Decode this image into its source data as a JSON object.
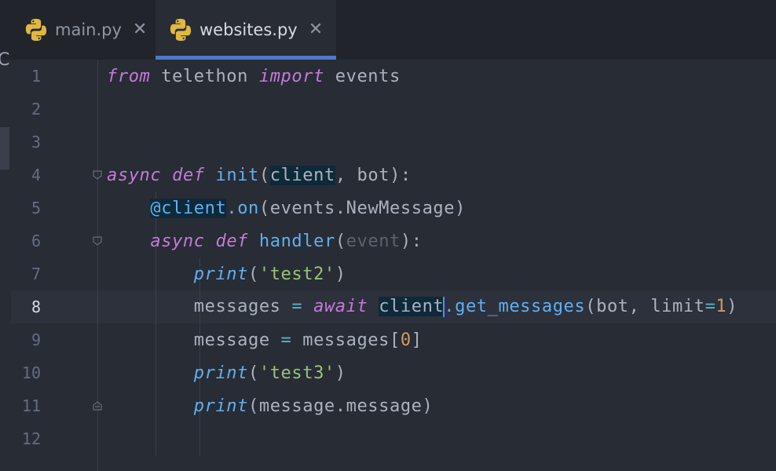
{
  "tabs": [
    {
      "label": "main.py",
      "close": "✕",
      "icon": "python-icon"
    },
    {
      "label": "websites.py",
      "close": "✕",
      "icon": "python-icon",
      "active": true
    }
  ],
  "edge_char": "C",
  "colors": {
    "keyword": "#c678dd",
    "function": "#61afef",
    "string": "#98c379",
    "number": "#d19a66",
    "operator": "#56b6c2",
    "text": "#abb2bf",
    "accent": "#4d78cc"
  },
  "editor": {
    "active_line": 8,
    "lines": [
      {
        "n": "1",
        "t": {
          "a": "from",
          "b": " telethon ",
          "c": "import",
          "d": " events"
        }
      },
      {
        "n": "2"
      },
      {
        "n": "3"
      },
      {
        "n": "4",
        "t": {
          "a": "async",
          "b": " ",
          "c": "def",
          "d": " ",
          "e": "init",
          "f": "(",
          "g": "client",
          "h": ", bot",
          "i": "):"
        }
      },
      {
        "n": "5",
        "t": {
          "a": "    ",
          "b": "@",
          "c": "client",
          "d": ".",
          "e": "on",
          "f": "(events.NewMessage)"
        }
      },
      {
        "n": "6",
        "t": {
          "a": "    ",
          "b": "async",
          "c": " ",
          "d": "def",
          "e": " ",
          "f": "handler",
          "g": "(",
          "h": "event",
          "i": "):"
        }
      },
      {
        "n": "7",
        "t": {
          "a": "        ",
          "b": "print",
          "c": "(",
          "d": "'test2'",
          "e": ")"
        }
      },
      {
        "n": "8",
        "t": {
          "a": "        messages ",
          "b": "=",
          "c": " ",
          "d": "await",
          "e": " ",
          "f": "client",
          "g": ".get_messages",
          "h": "(bot, limit",
          "i": "=",
          "j": "1",
          "k": ")"
        }
      },
      {
        "n": "9",
        "t": {
          "a": "        message ",
          "b": "=",
          "c": " messages[",
          "d": "0",
          "e": "]"
        }
      },
      {
        "n": "10",
        "t": {
          "a": "        ",
          "b": "print",
          "c": "(",
          "d": "'test3'",
          "e": ")"
        }
      },
      {
        "n": "11",
        "t": {
          "a": "        ",
          "b": "print",
          "c": "(message.message)"
        }
      },
      {
        "n": "12"
      }
    ]
  }
}
